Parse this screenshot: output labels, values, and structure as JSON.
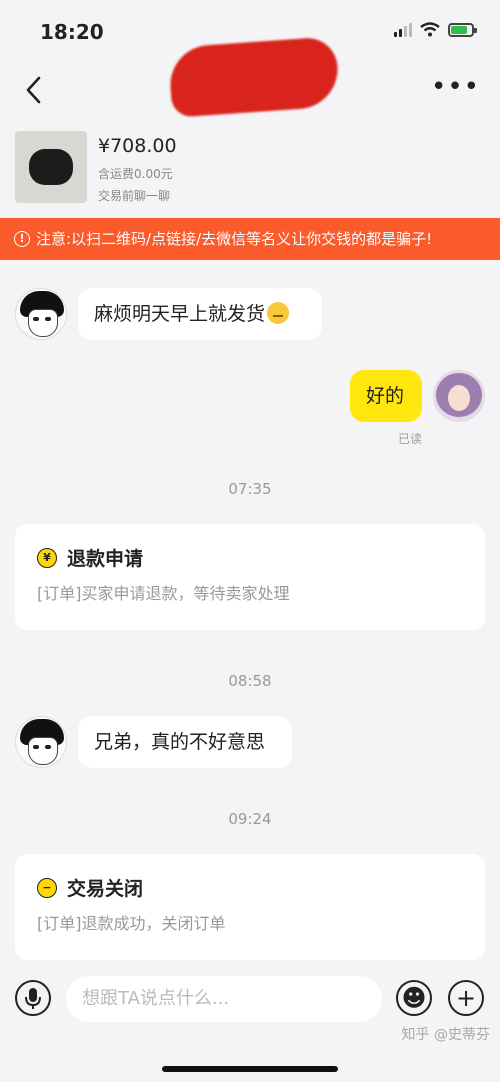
{
  "status_bar": {
    "time": "18:20"
  },
  "header": {
    "back_icon": "chevron-left-icon",
    "more_icon": "more-dots-icon",
    "more_label": "•••"
  },
  "product": {
    "price": "¥708.00",
    "shipping": "含运费0.00元",
    "chat_first": "交易前聊一聊"
  },
  "warning": {
    "icon": "!",
    "text": "注意:以扫二维码/点链接/去微信等名义让你交钱的都是骗子!"
  },
  "messages": [
    {
      "text": "麻烦明天早上就发货"
    },
    {
      "text": "好的",
      "status": "已读"
    }
  ],
  "timestamps": [
    "07:35",
    "08:58",
    "09:24"
  ],
  "refund_card": {
    "icon": "¥",
    "title": "退款申请",
    "desc": "[订单]买家申请退款，等待卖家处理"
  },
  "message_after_refund": {
    "text": "兄弟，真的不好意思"
  },
  "closed_card": {
    "icon": "−",
    "title": "交易关闭",
    "desc": "[订单]退款成功，关闭订单"
  },
  "input_bar": {
    "placeholder": "想跟TA说点什么...",
    "emoji_glyph": "☻",
    "plus_glyph": "+"
  },
  "watermark": "知乎 @史蒂芬"
}
